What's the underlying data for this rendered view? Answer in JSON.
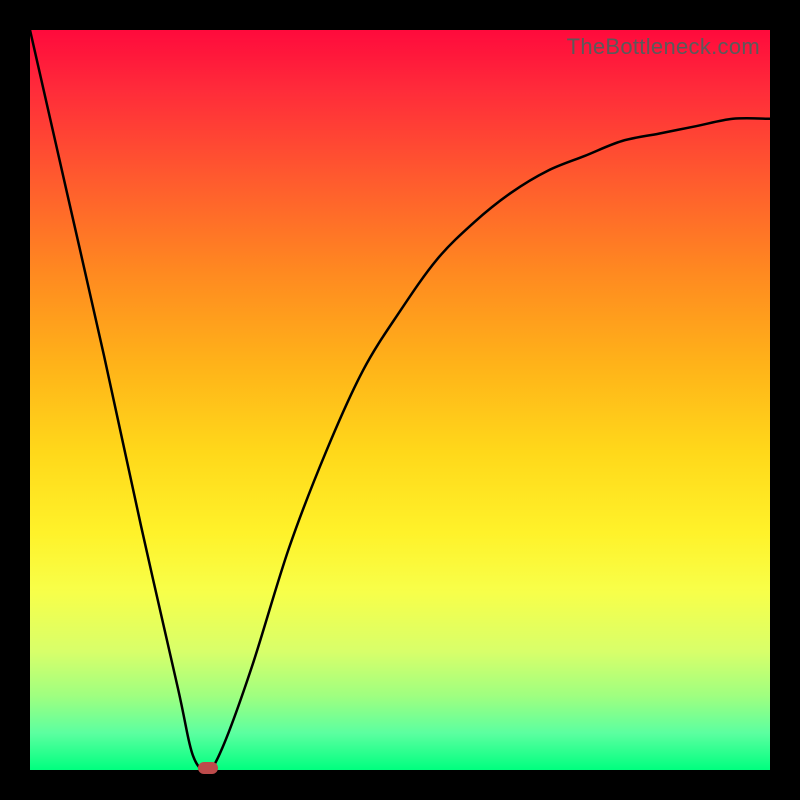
{
  "watermark": "TheBottleneck.com",
  "chart_data": {
    "type": "line",
    "title": "",
    "xlabel": "",
    "ylabel": "",
    "x_range": [
      0,
      100
    ],
    "y_range": [
      0,
      100
    ],
    "grid": false,
    "legend": false,
    "background_gradient": {
      "top": "#ff0a3c",
      "bottom": "#00ff7f"
    },
    "series": [
      {
        "name": "bottleneck-curve",
        "x": [
          0,
          5,
          10,
          15,
          20,
          22,
          24,
          26,
          30,
          35,
          40,
          45,
          50,
          55,
          60,
          65,
          70,
          75,
          80,
          85,
          90,
          95,
          100
        ],
        "y": [
          100,
          78,
          56,
          33,
          11,
          2,
          0,
          3,
          14,
          30,
          43,
          54,
          62,
          69,
          74,
          78,
          81,
          83,
          85,
          86,
          87,
          88,
          88
        ]
      }
    ],
    "marker": {
      "name": "optimal-point",
      "x": 24,
      "y": 0,
      "color": "#bd4b4b"
    }
  }
}
